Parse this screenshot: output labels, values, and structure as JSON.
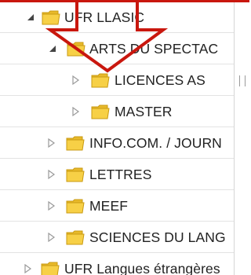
{
  "tree": {
    "rows": [
      {
        "label": "UFR LLASIC",
        "expanded": true,
        "toggle_icon": "triangle-down-filled",
        "folder_icon": "folder-icon"
      },
      {
        "label": "ARTS DU SPECTAC",
        "expanded": true,
        "toggle_icon": "triangle-down-filled",
        "folder_icon": "folder-icon"
      },
      {
        "label": "LICENCES AS",
        "expanded": false,
        "toggle_icon": "triangle-right-outline",
        "folder_icon": "folder-icon"
      },
      {
        "label": "MASTER",
        "expanded": false,
        "toggle_icon": "triangle-right-outline",
        "folder_icon": "folder-icon"
      },
      {
        "label": "INFO.COM. / JOURN",
        "expanded": false,
        "toggle_icon": "triangle-right-outline",
        "folder_icon": "folder-icon"
      },
      {
        "label": "LETTRES",
        "expanded": false,
        "toggle_icon": "triangle-right-outline",
        "folder_icon": "folder-icon"
      },
      {
        "label": "MEEF",
        "expanded": false,
        "toggle_icon": "triangle-right-outline",
        "folder_icon": "folder-icon"
      },
      {
        "label": "SCIENCES DU LANG",
        "expanded": false,
        "toggle_icon": "triangle-right-outline",
        "folder_icon": "folder-icon"
      },
      {
        "label": "UFR Langues étrangères",
        "expanded": false,
        "toggle_icon": "triangle-right-outline",
        "folder_icon": "folder-icon"
      }
    ]
  },
  "overlay": {
    "annotation": "down-arrow-callout",
    "color": "#c9170e"
  },
  "colors": {
    "folder_fill": "#f7d046",
    "folder_edge": "#c99a12",
    "row_separator": "#e3e3e3",
    "text": "#222222"
  }
}
